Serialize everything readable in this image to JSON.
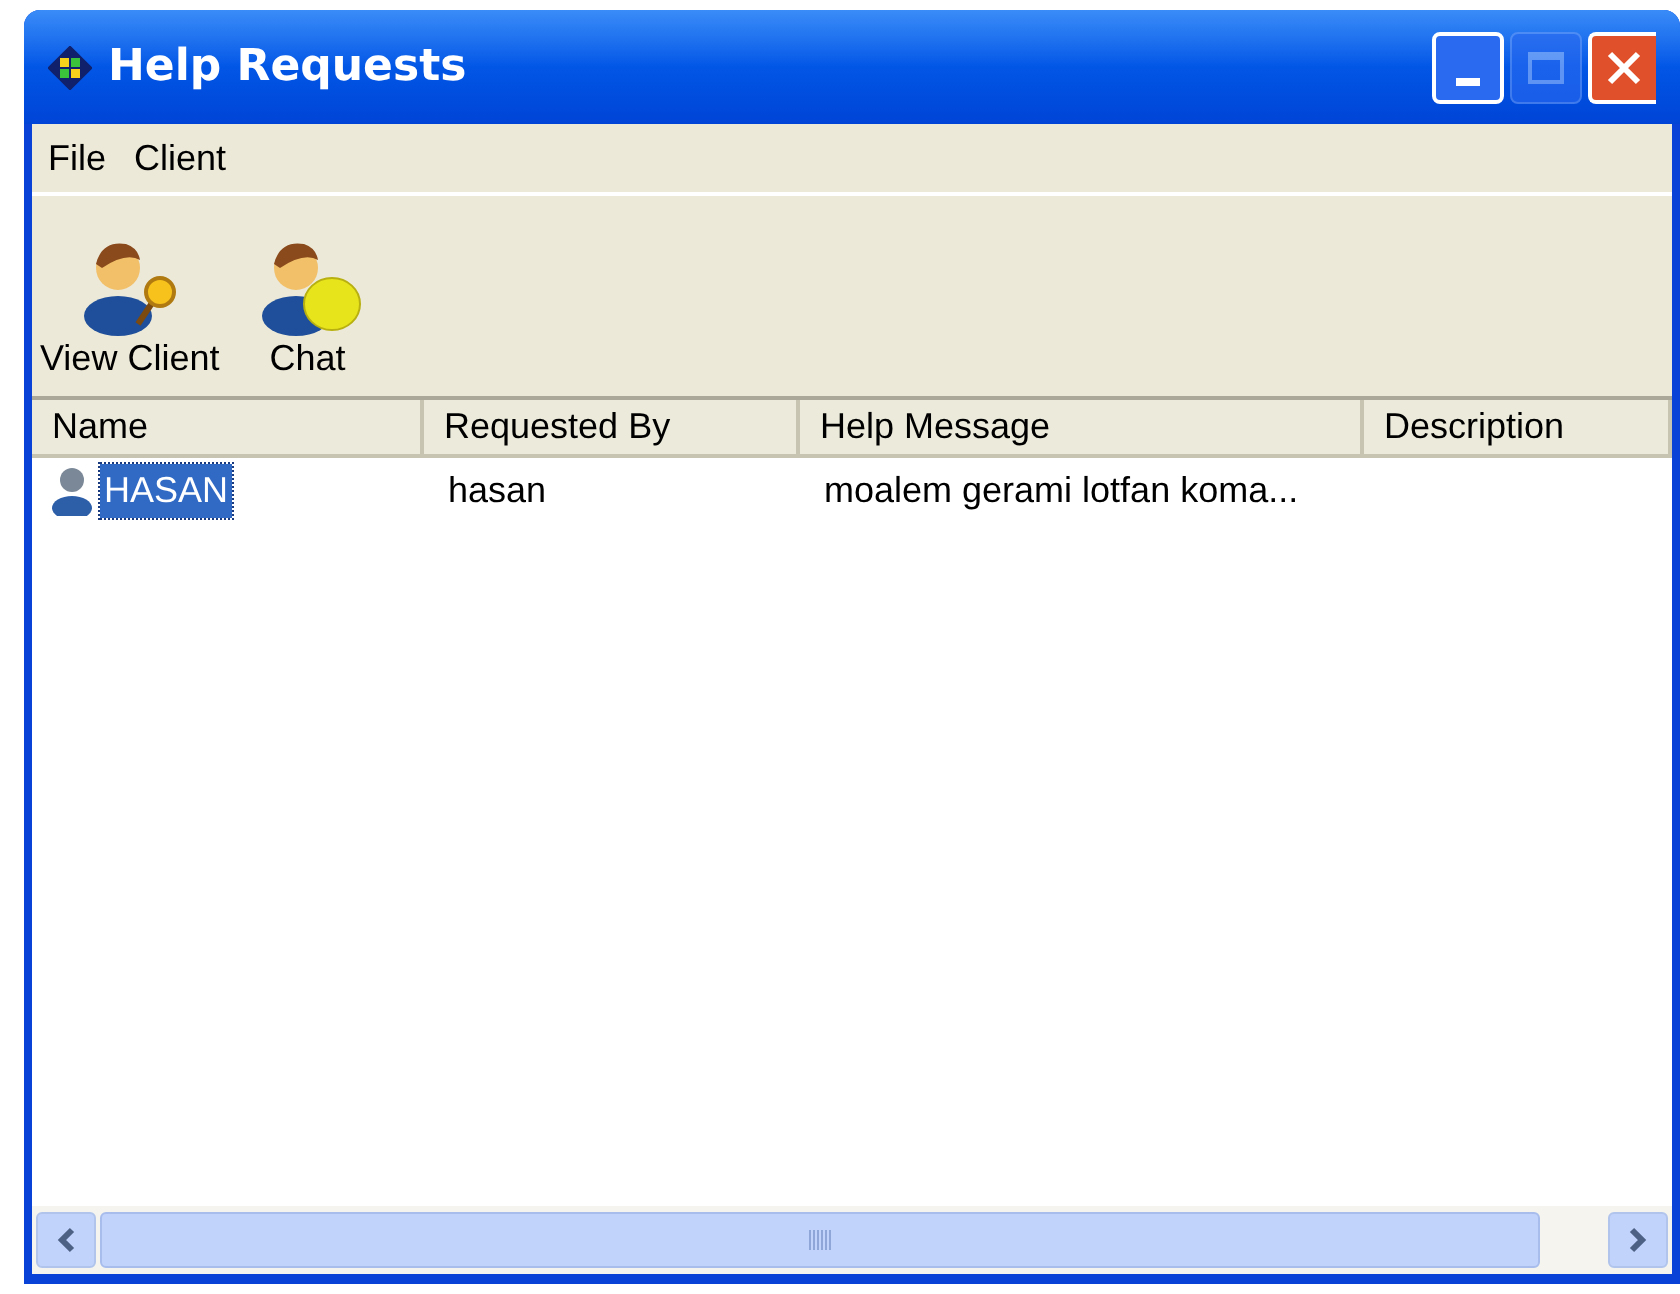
{
  "window": {
    "title": "Help Requests"
  },
  "menu": [
    "File",
    "Client"
  ],
  "toolbar": [
    {
      "kind": "view",
      "label": "View Client"
    },
    {
      "kind": "chat",
      "label": "Chat"
    }
  ],
  "table": {
    "columns": [
      "Name",
      "Requested By",
      "Help Message",
      "Description"
    ],
    "rows": [
      {
        "name": "HASAN",
        "requested_by": "hasan",
        "help_message": "moalem gerami lotfan koma...",
        "selected": true
      }
    ]
  }
}
